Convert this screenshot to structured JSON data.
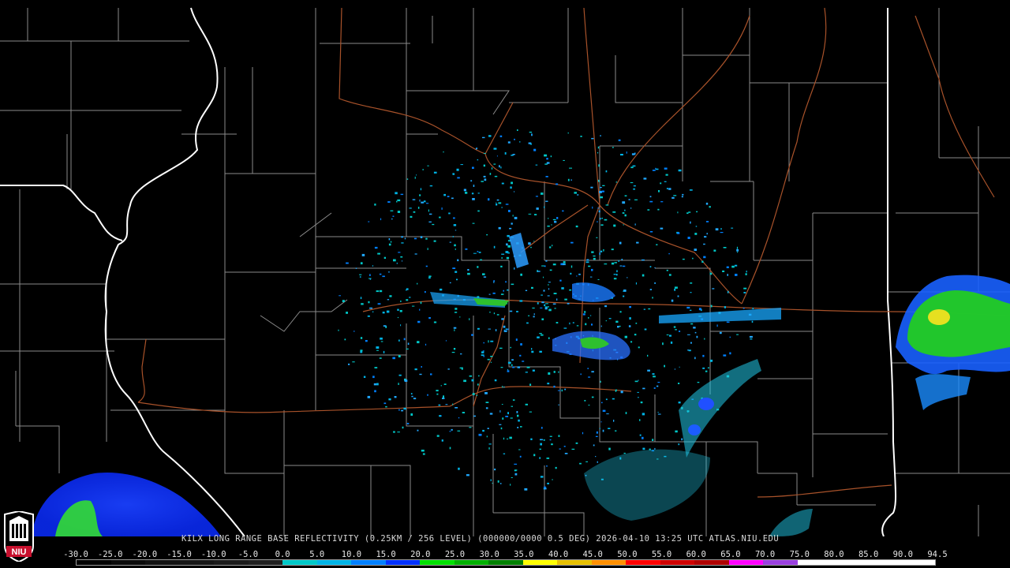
{
  "product": {
    "caption": "KILX LONG RANGE BASE REFLECTIVITY (0.25KM / 256 LEVEL) (000000/0000 0.5 DEG) 2026-04-10 13:25 UTC  ATLAS.NIU.EDU"
  },
  "logo": {
    "label": "NIU"
  },
  "legend": {
    "ticks": [
      "-30.0",
      "-25.0",
      "-20.0",
      "-15.0",
      "-10.0",
      "-5.0",
      "0.0",
      "5.0",
      "10.0",
      "15.0",
      "20.0",
      "25.0",
      "30.0",
      "35.0",
      "40.0",
      "45.0",
      "50.0",
      "55.0",
      "60.0",
      "65.0",
      "70.0",
      "75.0",
      "80.0",
      "85.0",
      "90.0",
      "94.5"
    ],
    "colors": [
      "#000000",
      "#0a0a0a",
      "#111111",
      "#161616",
      "#1b1b1b",
      "#202020",
      "#00c8c8",
      "#00b4e6",
      "#0080ff",
      "#0030ff",
      "#00e000",
      "#00b000",
      "#008000",
      "#ffff00",
      "#e6c000",
      "#ff9000",
      "#ff0000",
      "#d00000",
      "#b00000",
      "#ff00ff",
      "#9a40e0",
      "#ffffff",
      "#ffffff",
      "#ffffff",
      "#ffffff"
    ]
  },
  "colors": {
    "county_lines": "#8a8a8a",
    "state_lines": "#ffffff",
    "highways": "#a8522a"
  }
}
